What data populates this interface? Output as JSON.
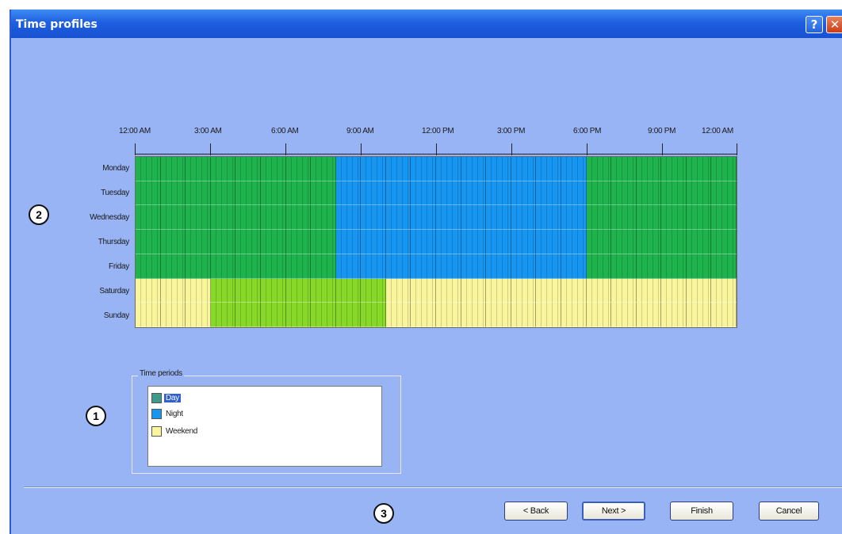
{
  "window": {
    "title": "Time profiles",
    "help_label": "?",
    "close_label": "✕"
  },
  "schedule": {
    "hour_labels": [
      "12:00 AM",
      "3:00 AM",
      "6:00 AM",
      "9:00 AM",
      "12:00 PM",
      "3:00 PM",
      "6:00 PM",
      "9:00 PM",
      "12:00 AM"
    ],
    "days": [
      "Monday",
      "Tuesday",
      "Wednesday",
      "Thursday",
      "Friday",
      "Saturday",
      "Sunday"
    ],
    "colors": {
      "day": "#1fb34d",
      "night": "#1696f0",
      "weekend": "#f8f59c",
      "weekend_highlight": "#88d82a"
    },
    "rows": [
      {
        "day": "Monday",
        "hours": [
          "day",
          "day",
          "day",
          "day",
          "day",
          "day",
          "day",
          "day",
          "night",
          "night",
          "night",
          "night",
          "night",
          "night",
          "night",
          "night",
          "night",
          "night",
          "day",
          "day",
          "day",
          "day",
          "day",
          "day"
        ]
      },
      {
        "day": "Tuesday",
        "hours": [
          "day",
          "day",
          "day",
          "day",
          "day",
          "day",
          "day",
          "day",
          "night",
          "night",
          "night",
          "night",
          "night",
          "night",
          "night",
          "night",
          "night",
          "night",
          "day",
          "day",
          "day",
          "day",
          "day",
          "day"
        ]
      },
      {
        "day": "Wednesday",
        "hours": [
          "day",
          "day",
          "day",
          "day",
          "day",
          "day",
          "day",
          "day",
          "night",
          "night",
          "night",
          "night",
          "night",
          "night",
          "night",
          "night",
          "night",
          "night",
          "day",
          "day",
          "day",
          "day",
          "day",
          "day"
        ]
      },
      {
        "day": "Thursday",
        "hours": [
          "day",
          "day",
          "day",
          "day",
          "day",
          "day",
          "day",
          "day",
          "night",
          "night",
          "night",
          "night",
          "night",
          "night",
          "night",
          "night",
          "night",
          "night",
          "day",
          "day",
          "day",
          "day",
          "day",
          "day"
        ]
      },
      {
        "day": "Friday",
        "hours": [
          "day",
          "day",
          "day",
          "day",
          "day",
          "day",
          "day",
          "day",
          "night",
          "night",
          "night",
          "night",
          "night",
          "night",
          "night",
          "night",
          "night",
          "night",
          "day",
          "day",
          "day",
          "day",
          "day",
          "day"
        ]
      },
      {
        "day": "Saturday",
        "hours": [
          "weekend",
          "weekend",
          "weekend",
          "weekend_highlight",
          "weekend_highlight",
          "weekend_highlight",
          "weekend_highlight",
          "weekend_highlight",
          "weekend_highlight",
          "weekend_highlight",
          "weekend",
          "weekend",
          "weekend",
          "weekend",
          "weekend",
          "weekend",
          "weekend",
          "weekend",
          "weekend",
          "weekend",
          "weekend",
          "weekend",
          "weekend",
          "weekend"
        ]
      },
      {
        "day": "Sunday",
        "hours": [
          "weekend",
          "weekend",
          "weekend",
          "weekend_highlight",
          "weekend_highlight",
          "weekend_highlight",
          "weekend_highlight",
          "weekend_highlight",
          "weekend_highlight",
          "weekend_highlight",
          "weekend",
          "weekend",
          "weekend",
          "weekend",
          "weekend",
          "weekend",
          "weekend",
          "weekend",
          "weekend",
          "weekend",
          "weekend",
          "weekend",
          "weekend",
          "weekend"
        ]
      }
    ]
  },
  "time_periods": {
    "label": "Time periods",
    "items": [
      {
        "label": "Day",
        "color": "#3e9b8a",
        "selected": true
      },
      {
        "label": "Night",
        "color": "#1696f0",
        "selected": false
      },
      {
        "label": "Weekend",
        "color": "#f8f59c",
        "selected": false
      }
    ]
  },
  "callouts": {
    "one": "1",
    "two": "2",
    "three": "3"
  },
  "buttons": {
    "back": "< Back",
    "next": "Next >",
    "finish": "Finish",
    "cancel": "Cancel"
  }
}
